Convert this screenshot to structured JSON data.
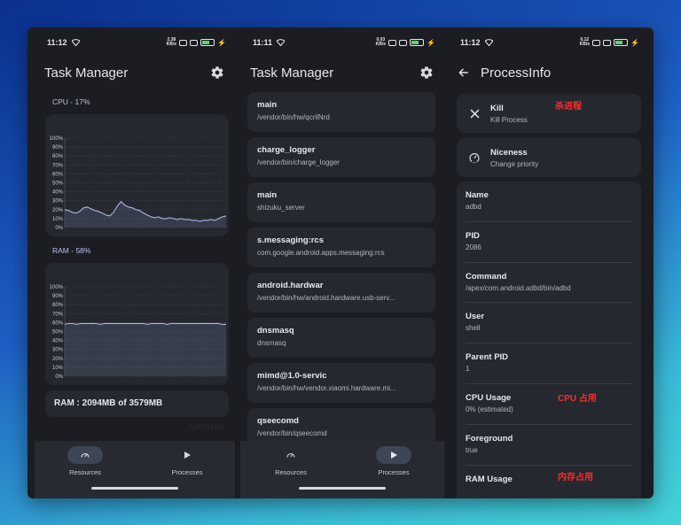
{
  "status": {
    "p1": {
      "time": "11:12",
      "speed": "2.38\nKB/s"
    },
    "p2": {
      "time": "11:11",
      "speed": "0.03\nKB/s"
    },
    "p3": {
      "time": "11:12",
      "speed": "0.12\nKB/s"
    }
  },
  "app": {
    "title": "Task Manager",
    "settings_icon": "gear-icon"
  },
  "resources": {
    "cpu_label": "CPU - 17%",
    "ram_label": "RAM - 58%",
    "ram_summary": "RAM : 2094MB of 3579MB",
    "watermark": "APPINN"
  },
  "chart_data": [
    {
      "type": "area",
      "title": "CPU - 17%",
      "y_ticks": [
        "100%",
        "90%",
        "80%",
        "70%",
        "60%",
        "50%",
        "40%",
        "30%",
        "20%",
        "10%",
        "0%"
      ],
      "ylim": [
        0,
        100
      ],
      "grid": true,
      "values": [
        20,
        19,
        17,
        16,
        18,
        22,
        23,
        21,
        19,
        18,
        16,
        14,
        13,
        17,
        24,
        29,
        25,
        23,
        22,
        20,
        19,
        16,
        14,
        12,
        11,
        12,
        10,
        10,
        11,
        10,
        9,
        10,
        9,
        9,
        8,
        8,
        7,
        8,
        8,
        9,
        8,
        10,
        12,
        13
      ]
    },
    {
      "type": "area",
      "title": "RAM - 58%",
      "y_ticks": [
        "100%",
        "90%",
        "80%",
        "70%",
        "60%",
        "50%",
        "40%",
        "30%",
        "20%",
        "10%",
        "0%"
      ],
      "ylim": [
        0,
        100
      ],
      "grid": true,
      "values": [
        58,
        59,
        59,
        58,
        59,
        59,
        59,
        59,
        59,
        58,
        59,
        59,
        59,
        59,
        59,
        59,
        59,
        59,
        59,
        59,
        59,
        58,
        59,
        59,
        59,
        59,
        58,
        59,
        59,
        59,
        59,
        59,
        59,
        59,
        59,
        59,
        59,
        59,
        59,
        59,
        58,
        58
      ]
    }
  ],
  "nav": {
    "resources": "Resources",
    "processes": "Processes"
  },
  "processes": [
    {
      "name": "main",
      "path": "/vendor/bin/hw/qcrilNrd"
    },
    {
      "name": "charge_logger",
      "path": "/vendor/bin/charge_logger"
    },
    {
      "name": "main",
      "path": "shizuku_server"
    },
    {
      "name": "s.messaging:rcs",
      "path": "com.google.android.apps.messaging:rcs"
    },
    {
      "name": "android.hardwar",
      "path": "/vendor/bin/hw/android.hardware.usb-serv..."
    },
    {
      "name": "dnsmasq",
      "path": "dnsmasq"
    },
    {
      "name": "mimd@1.0-servic",
      "path": "/vendor/bin/hw/vendor.xiaomi.hardware.mi..."
    },
    {
      "name": "qseecomd",
      "path": "/vendor/bin/qseecomd"
    }
  ],
  "process_info": {
    "title": "ProcessInfo",
    "kill": {
      "title": "Kill",
      "subtitle": "Kill Process"
    },
    "niceness": {
      "title": "Niceness",
      "subtitle": "Change priority"
    },
    "fields": [
      {
        "label": "Name",
        "value": "adbd"
      },
      {
        "label": "PID",
        "value": "2086"
      },
      {
        "label": "Command",
        "value": "/apex/com.android.adbd/bin/adbd"
      },
      {
        "label": "User",
        "value": "shell"
      },
      {
        "label": "Parent PID",
        "value": "1"
      },
      {
        "label": "CPU Usage",
        "value": "0% (estimated)"
      },
      {
        "label": "Foreground",
        "value": "true"
      },
      {
        "label": "RAM Usage",
        "value": ""
      }
    ],
    "annotations": {
      "kill": "杀进程",
      "cpu": "CPU 占用",
      "ram": "内存占用"
    }
  },
  "colors": {
    "accent": "#b9c3e8",
    "card": "#25282f",
    "background": "#1b1d23",
    "chart_line": "#aab6e6",
    "annotation": "#ff2c2c"
  }
}
